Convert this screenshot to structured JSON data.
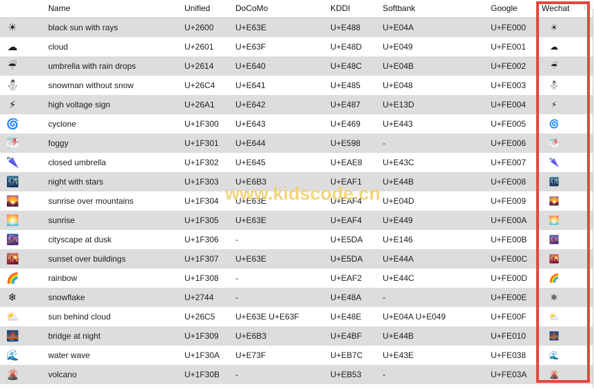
{
  "table": {
    "columns": [
      {
        "key": "icon",
        "label": ""
      },
      {
        "key": "name",
        "label": "Name"
      },
      {
        "key": "unified",
        "label": "Unified"
      },
      {
        "key": "docomo",
        "label": "DoCoMo"
      },
      {
        "key": "kddi",
        "label": "KDDI"
      },
      {
        "key": "softbank",
        "label": "Softbank"
      },
      {
        "key": "google",
        "label": "Google"
      },
      {
        "key": "wechat",
        "label": "Wechat"
      }
    ],
    "rows": [
      {
        "icon": "☀",
        "icon_name": "black-sun-with-rays-icon",
        "name": "black sun with rays",
        "unified": "U+2600",
        "docomo": "U+E63E",
        "kddi": "U+E488",
        "softbank": "U+E04A",
        "google": "U+FE000",
        "wechat": "☀"
      },
      {
        "icon": "☁",
        "icon_name": "cloud-icon",
        "name": "cloud",
        "unified": "U+2601",
        "docomo": "U+E63F",
        "kddi": "U+E48D",
        "softbank": "U+E049",
        "google": "U+FE001",
        "wechat": "☁"
      },
      {
        "icon": "☔",
        "icon_name": "umbrella-with-rain-drops-icon",
        "name": "umbrella with rain drops",
        "unified": "U+2614",
        "docomo": "U+E640",
        "kddi": "U+E48C",
        "softbank": "U+E04B",
        "google": "U+FE002",
        "wechat": "☔"
      },
      {
        "icon": "⛄",
        "icon_name": "snowman-without-snow-icon",
        "name": "snowman without snow",
        "unified": "U+26C4",
        "docomo": "U+E641",
        "kddi": "U+E485",
        "softbank": "U+E048",
        "google": "U+FE003",
        "wechat": "⛄"
      },
      {
        "icon": "⚡",
        "icon_name": "high-voltage-sign-icon",
        "name": "high voltage sign",
        "unified": "U+26A1",
        "docomo": "U+E642",
        "kddi": "U+E487",
        "softbank": "U+E13D",
        "google": "U+FE004",
        "wechat": "⚡"
      },
      {
        "icon": "🌀",
        "icon_name": "cyclone-icon",
        "name": "cyclone",
        "unified": "U+1F300",
        "docomo": "U+E643",
        "kddi": "U+E469",
        "softbank": "U+E443",
        "google": "U+FE005",
        "wechat": "🌀"
      },
      {
        "icon": "🌁",
        "icon_name": "foggy-icon",
        "name": "foggy",
        "unified": "U+1F301",
        "docomo": "U+E644",
        "kddi": "U+E598",
        "softbank": "-",
        "google": "U+FE006",
        "wechat": "🌁"
      },
      {
        "icon": "🌂",
        "icon_name": "closed-umbrella-icon",
        "name": "closed umbrella",
        "unified": "U+1F302",
        "docomo": "U+E645",
        "kddi": "U+EAE8",
        "softbank": "U+E43C",
        "google": "U+FE007",
        "wechat": "🌂"
      },
      {
        "icon": "🌃",
        "icon_name": "night-with-stars-icon",
        "name": "night with stars",
        "unified": "U+1F303",
        "docomo": "U+E6B3",
        "kddi": "U+EAF1",
        "softbank": "U+E44B",
        "google": "U+FE008",
        "wechat": "🌃"
      },
      {
        "icon": "🌄",
        "icon_name": "sunrise-over-mountains-icon",
        "name": "sunrise over mountains",
        "unified": "U+1F304",
        "docomo": "U+E63E",
        "kddi": "U+EAF4",
        "softbank": "U+E04D",
        "google": "U+FE009",
        "wechat": "🌄"
      },
      {
        "icon": "🌅",
        "icon_name": "sunrise-icon",
        "name": "sunrise",
        "unified": "U+1F305",
        "docomo": "U+E63E",
        "kddi": "U+EAF4",
        "softbank": "U+E449",
        "google": "U+FE00A",
        "wechat": "🌅"
      },
      {
        "icon": "🌆",
        "icon_name": "cityscape-at-dusk-icon",
        "name": "cityscape at dusk",
        "unified": "U+1F306",
        "docomo": "-",
        "kddi": "U+E5DA",
        "softbank": "U+E146",
        "google": "U+FE00B",
        "wechat": "🌆"
      },
      {
        "icon": "🌇",
        "icon_name": "sunset-over-buildings-icon",
        "name": "sunset over buildings",
        "unified": "U+1F307",
        "docomo": "U+E63E",
        "kddi": "U+E5DA",
        "softbank": "U+E44A",
        "google": "U+FE00C",
        "wechat": "🌇"
      },
      {
        "icon": "🌈",
        "icon_name": "rainbow-icon",
        "name": "rainbow",
        "unified": "U+1F308",
        "docomo": "-",
        "kddi": "U+EAF2",
        "softbank": "U+E44C",
        "google": "U+FE00D",
        "wechat": "🌈"
      },
      {
        "icon": "❄",
        "icon_name": "snowflake-icon",
        "name": "snowflake",
        "unified": "U+2744",
        "docomo": "-",
        "kddi": "U+E48A",
        "softbank": "-",
        "google": "U+FE00E",
        "wechat": "❄"
      },
      {
        "icon": "⛅",
        "icon_name": "sun-behind-cloud-icon",
        "name": "sun behind cloud",
        "unified": "U+26C5",
        "docomo": "U+E63E U+E63F",
        "kddi": "U+E48E",
        "softbank": "U+E04A U+E049",
        "google": "U+FE00F",
        "wechat": "⛅"
      },
      {
        "icon": "🌉",
        "icon_name": "bridge-at-night-icon",
        "name": "bridge at night",
        "unified": "U+1F309",
        "docomo": "U+E6B3",
        "kddi": "U+E4BF",
        "softbank": "U+E44B",
        "google": "U+FE010",
        "wechat": "🌉"
      },
      {
        "icon": "🌊",
        "icon_name": "water-wave-icon",
        "name": "water wave",
        "unified": "U+1F30A",
        "docomo": "U+E73F",
        "kddi": "U+EB7C",
        "softbank": "U+E43E",
        "google": "U+FE038",
        "wechat": "🌊"
      },
      {
        "icon": "🌋",
        "icon_name": "volcano-icon",
        "name": "volcano",
        "unified": "U+1F30B",
        "docomo": "-",
        "kddi": "U+EB53",
        "softbank": "-",
        "google": "U+FE03A",
        "wechat": "🌋"
      }
    ]
  },
  "watermark": {
    "text": "www.kidscode.cn",
    "color": "#f2d16b"
  },
  "highlight": {
    "column": "Wechat",
    "color": "#e8453c"
  },
  "colors": {
    "row_odd": "#dddddd",
    "row_even": "#ffffff",
    "text": "#1c1c1c"
  }
}
